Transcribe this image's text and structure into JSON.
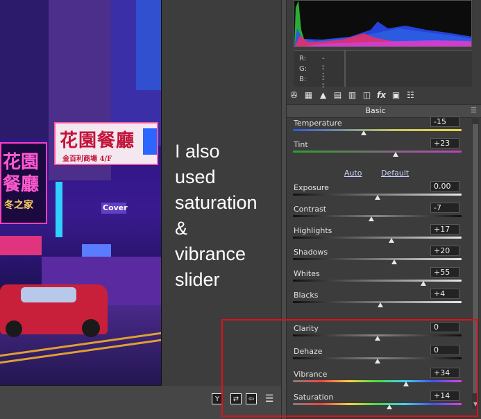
{
  "annotation": {
    "lines": [
      "I also",
      "used",
      "saturation",
      "&",
      "vibrance",
      "slider"
    ]
  },
  "photo": {
    "sign_main": "花園餐廳",
    "sign_sub": "金百利商場 4/F",
    "sign_left_1": "花園",
    "sign_left_2": "餐廳",
    "sign_left_3": "冬之家",
    "sign_cover": "Cover"
  },
  "tools": {
    "y_button": "Y",
    "swap_icon": "swap-icon",
    "copy_icon": "copy-settings-icon",
    "prefs_icon": "sliders-icon"
  },
  "rgb": {
    "r_label": "R:",
    "r_value": "---",
    "g_label": "G:",
    "g_value": "---",
    "b_label": "B:",
    "b_value": "---"
  },
  "panel_tabs": [
    "aperture-icon",
    "grid-icon",
    "mountain-icon",
    "split-toning-icon",
    "hsl-icon",
    "lens-icon",
    "fx-icon",
    "camera-icon",
    "presets-icon"
  ],
  "section": {
    "title": "Basic",
    "menu_icon": "menu-icon"
  },
  "auto_label": "Auto",
  "default_label": "Default",
  "controls": [
    {
      "key": "temperature",
      "label": "Temperature",
      "value": "-15",
      "position": 0.42
    },
    {
      "key": "tint",
      "label": "Tint",
      "value": "+23",
      "position": 0.61
    },
    {
      "key": "exposure",
      "label": "Exposure",
      "value": "0.00",
      "position": 0.5
    },
    {
      "key": "contrast",
      "label": "Contrast",
      "value": "-7",
      "position": 0.465
    },
    {
      "key": "highlights",
      "label": "Highlights",
      "value": "+17",
      "position": 0.585
    },
    {
      "key": "shadows",
      "label": "Shadows",
      "value": "+20",
      "position": 0.6
    },
    {
      "key": "whites",
      "label": "Whites",
      "value": "+55",
      "position": 0.775
    },
    {
      "key": "blacks",
      "label": "Blacks",
      "value": "+4",
      "position": 0.52
    },
    {
      "key": "clarity",
      "label": "Clarity",
      "value": "0",
      "position": 0.5
    },
    {
      "key": "dehaze",
      "label": "Dehaze",
      "value": "0",
      "position": 0.5
    },
    {
      "key": "vibrance",
      "label": "Vibrance",
      "value": "+34",
      "position": 0.67
    },
    {
      "key": "saturation",
      "label": "Saturation",
      "value": "+14",
      "position": 0.57
    }
  ],
  "colors": {
    "highlight_box": "#e0101a",
    "link": "#c8d4ff"
  }
}
